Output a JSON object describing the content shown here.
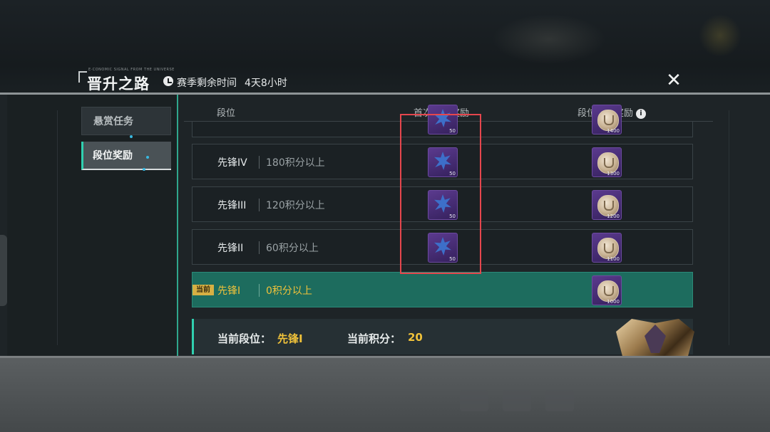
{
  "header": {
    "title": "晋升之路",
    "title_small": "E·CONOMIC SIGNAL FROM THE UNIVERSE",
    "season_label": "赛季剩余时间",
    "season_remaining": "4天8小时"
  },
  "nav": {
    "items": [
      {
        "label": "悬赏任务"
      },
      {
        "label": "段位奖励"
      }
    ],
    "active": "段位奖励"
  },
  "table": {
    "columns": {
      "rank": "段位",
      "first_promo": "首次晋升奖励",
      "settle": "段位结算奖励"
    },
    "partial_row": {
      "promo_qty": "50",
      "settle_qty": "1400"
    },
    "rows": [
      {
        "rank": "先锋IV",
        "score": "180积分以上",
        "promo_qty": "50",
        "settle_qty": "1300"
      },
      {
        "rank": "先锋III",
        "score": "120积分以上",
        "promo_qty": "50",
        "settle_qty": "1200"
      },
      {
        "rank": "先锋II",
        "score": "60积分以上",
        "promo_qty": "50",
        "settle_qty": "1100"
      },
      {
        "rank": "先锋I",
        "score": "0积分以上",
        "settle_qty": "1000",
        "tag": "当前"
      }
    ]
  },
  "status": {
    "rank_label": "当前段位：",
    "rank_value": "先锋I",
    "score_label": "当前积分：",
    "score_value": "20"
  },
  "icons": {
    "timer": "clock-icon",
    "close": "close-icon",
    "info": "info-icon",
    "promo_item": "crystal-icon",
    "settle_item": "medal-icon"
  },
  "colors": {
    "accent": "#30d0b0",
    "current_row": "#1d6c5e",
    "highlight": "#e5464d",
    "gold_text": "#f0c23a"
  }
}
